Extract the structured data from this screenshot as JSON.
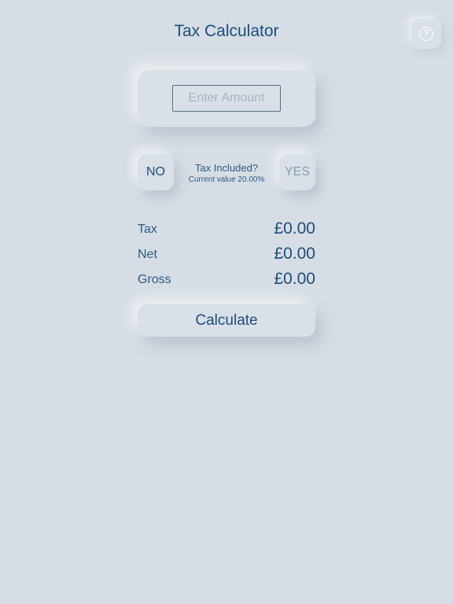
{
  "header": {
    "title": "Tax Calculator"
  },
  "help": {
    "icon": "help-circle-icon",
    "glyph": "?"
  },
  "amount": {
    "placeholder": "Enter Amount",
    "value": ""
  },
  "tax_toggle": {
    "no_label": "NO",
    "yes_label": "YES",
    "question": "Tax Included?",
    "current_value": "Current value 20.00%",
    "selected": "NO"
  },
  "results": {
    "tax": {
      "label": "Tax",
      "value": "£0.00"
    },
    "net": {
      "label": "Net",
      "value": "£0.00"
    },
    "gross": {
      "label": "Gross",
      "value": "£0.00"
    }
  },
  "actions": {
    "calculate_label": "Calculate"
  },
  "colors": {
    "background": "#d6dde4",
    "accent": "#1d4d7c",
    "muted": "#8a9db0"
  }
}
